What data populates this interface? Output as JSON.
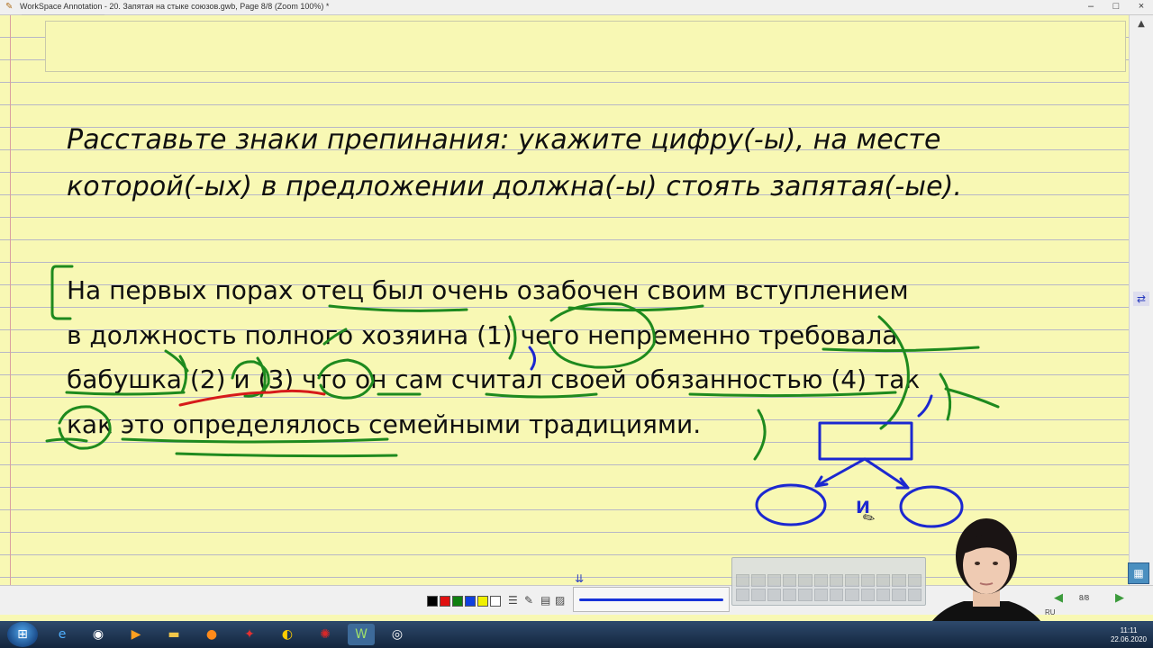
{
  "window": {
    "title": "WorkSpace Annotation - 20. Запятая на стыке союзов.gwb, Page 8/8  (Zoom 100%) *",
    "buttons": [
      "minimize",
      "maximize",
      "close"
    ],
    "minimize_glyph": "–",
    "maximize_glyph": "□",
    "close_glyph": "×"
  },
  "mini_toolbar": [
    "add-icon",
    "minus-icon",
    "edit-icon",
    "copy-icon"
  ],
  "task": {
    "line1": "Расставьте знаки препинания: укажите цифру(-ы), на месте",
    "line2": "которой(-ых) в предложении должна(-ы) стоять запятая(-ые)."
  },
  "sentence": {
    "line1": "На первых порах отец был очень озабочен своим вступлением",
    "line2": "в должность полного хозяина (1) чего непременно требовала",
    "line3": "бабушка (2) и (3) что он сам считал своей обязанностью (4) так",
    "line4": "как это определялось семейными традициями."
  },
  "annotation": {
    "conjunction_label": "и",
    "ink_colors": {
      "green": "#1e8a1e",
      "blue": "#1c28d0",
      "red": "#d61a1a"
    }
  },
  "toolbar": {
    "colors": [
      "#000000",
      "#e01010",
      "#108010",
      "#1040e0",
      "#f0f000",
      "#ffffff"
    ],
    "page_indicator": "8/8",
    "pen_color": "#1732d8"
  },
  "taskbar": {
    "apps": [
      "ie-icon",
      "chrome-icon",
      "media-player-icon",
      "folder-icon",
      "firefox-icon",
      "app-red-icon",
      "yandex-icon",
      "app-red2-icon",
      "workspace-icon",
      "obs-icon"
    ],
    "language": "RU",
    "time": "11:11",
    "date": "22.06.2020"
  }
}
